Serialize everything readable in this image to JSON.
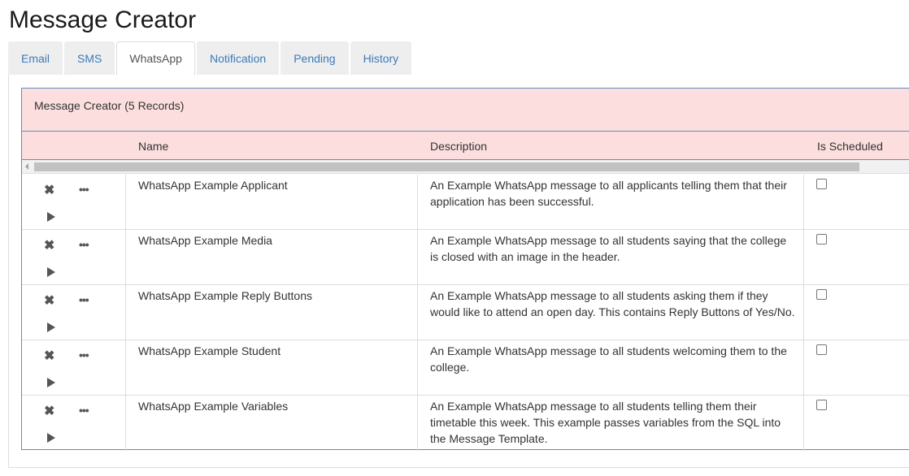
{
  "page": {
    "title": "Message Creator"
  },
  "tabs": [
    {
      "label": "Email"
    },
    {
      "label": "SMS"
    },
    {
      "label": "WhatsApp",
      "active": true
    },
    {
      "label": "Notification"
    },
    {
      "label": "Pending"
    },
    {
      "label": "History"
    }
  ],
  "panel": {
    "title": "Message Creator (5 Records)",
    "columns": {
      "name": "Name",
      "description": "Description",
      "is_scheduled": "Is Scheduled"
    }
  },
  "rows": [
    {
      "name": "WhatsApp Example Applicant",
      "description": "An Example WhatsApp message to all applicants telling them that their application has been successful.",
      "is_scheduled": false
    },
    {
      "name": "WhatsApp Example Media",
      "description": "An Example WhatsApp message to all students saying that the college is closed with an image in the header.",
      "is_scheduled": false
    },
    {
      "name": "WhatsApp Example Reply Buttons",
      "description": "An Example WhatsApp message to all students asking them if they would like to attend an open day. This contains Reply Buttons of Yes/No.",
      "is_scheduled": false
    },
    {
      "name": "WhatsApp Example Student",
      "description": "An Example WhatsApp message to all students welcoming them to the college.",
      "is_scheduled": false
    },
    {
      "name": "WhatsApp Example Variables",
      "description": "An Example WhatsApp message to all students telling them their timetable this week. This example passes variables from the SQL into the Message Template.",
      "is_scheduled": false
    }
  ],
  "icons": {
    "delete": "close-icon",
    "more": "ellipsis-icon",
    "run": "play-icon"
  },
  "colors": {
    "heading_bg": "#fcdede",
    "panel_border": "#5b8fc7",
    "tab_link": "#3d7ab8"
  }
}
